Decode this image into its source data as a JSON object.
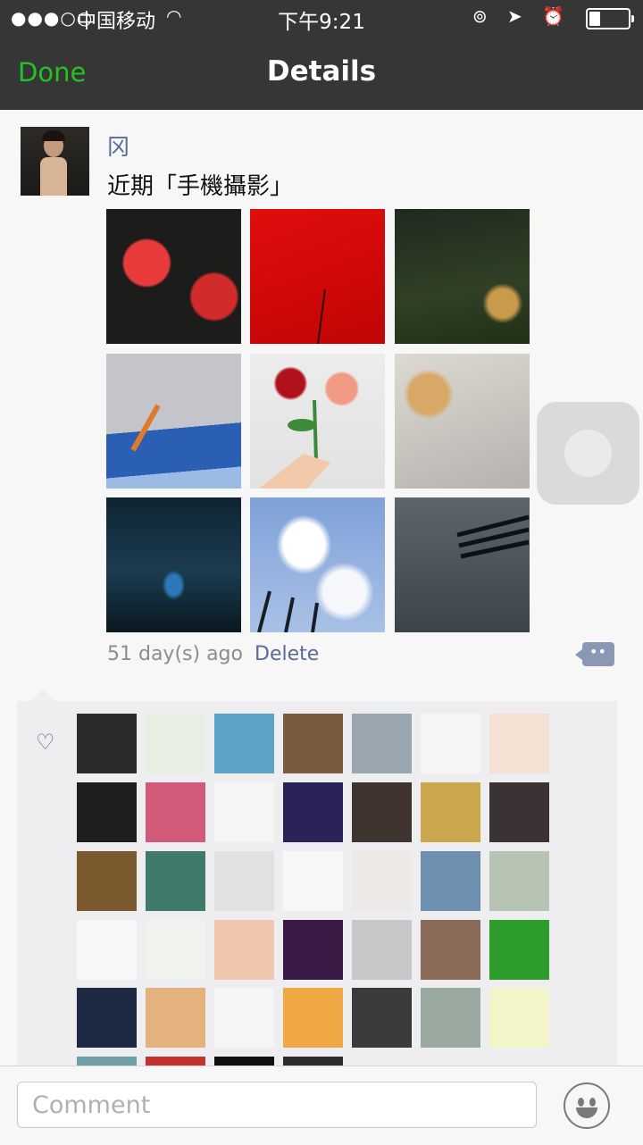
{
  "status_bar": {
    "signal": "●●●○○",
    "carrier": "中国移动",
    "wifi_icon": "wifi-icon",
    "time": "下午9:21",
    "right_icons": "⊚ ➤ ⏰"
  },
  "nav": {
    "done_label": "Done",
    "title": "Details",
    "done_color": "#22c322"
  },
  "post": {
    "username": "冈",
    "text": "近期「手機攝影」",
    "photos": [
      "red flowers",
      "red",
      "palm leaves",
      "drink carton",
      "rose bouquet",
      "fabric",
      "stage lights",
      "clouds",
      "shadow"
    ],
    "timestamp": "51 day(s) ago",
    "delete_label": "Delete",
    "comment_icon": "comment-bubble-icon"
  },
  "likes": {
    "icon": "heart-icon",
    "avatars": [
      "#2b2b2b",
      "#e7efe2",
      "#5ba4c7",
      "#7a5b3e",
      "#9aa7b0",
      "#f7f4f4",
      "#f3e2d3",
      "#1f1f1f",
      "#d25a79",
      "#f5f5f5",
      "#2a2359",
      "#3f3430",
      "#caa64c",
      "#3b3333",
      "#7a5a2e",
      "#3f7a6a",
      "#e1e1e1",
      "#f7f7f7",
      "#ece9e7",
      "#6f8fb0",
      "#b7c4b4",
      "#f7f7f7",
      "#f0f2ee",
      "#f0c7ae",
      "#3a1a44",
      "#c7c7c7",
      "#8a6a58",
      "#2d9e2b",
      "#1e2a44",
      "#e4b27c",
      "#f5f5f5",
      "#f0a845",
      "#3a3a3a",
      "#9aa9a0",
      "#f3f5c8",
      "#6fa0a5",
      "#c2322f",
      "#111111",
      "#2c2c2c"
    ]
  },
  "comment_bar": {
    "placeholder": "Comment",
    "emoji_icon": "emoji-face-icon"
  }
}
